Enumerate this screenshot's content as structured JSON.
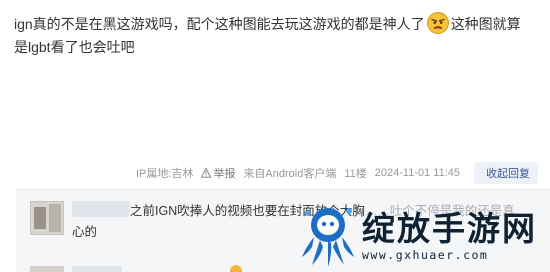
{
  "post": {
    "text_before_emoji": "ign真的不是在黑这游戏吗，配个这种图能去玩这游戏的都是神人了",
    "emoji_icon": "angry-face-emoji-icon",
    "text_after_emoji": "这种图就算是lgbt看了也会吐吧"
  },
  "meta": {
    "ip_location": "IP属地:吉林",
    "report_label": "举报",
    "client": "来自Android客户端",
    "floor": "11楼",
    "timestamp": "2024-11-01 11:45",
    "collapse_reply_label": "收起回复"
  },
  "reply": {
    "text_visible": "之前IGN吹捧人的视频也要在封面放个大胸",
    "text_obscured": "……吐个不停是我的还是真",
    "text_line2": "心的"
  },
  "watermark": {
    "title": "绽放手游网",
    "url": "www.gxhuaer.com"
  },
  "colors": {
    "link_blue": "#3a5a99",
    "meta_gray": "#999999",
    "reply_bg": "#f5f6f8",
    "watermark_blue": "#1e6fc4"
  }
}
